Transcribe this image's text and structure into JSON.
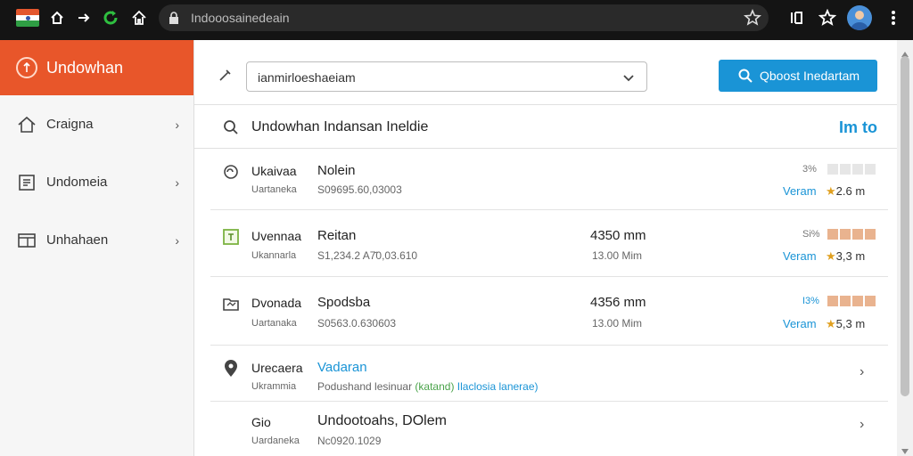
{
  "browser": {
    "url": "Indooosainedeain",
    "icons": [
      "flag-icon",
      "home-icon",
      "forward-icon",
      "reload-icon",
      "house-icon",
      "lock-icon",
      "bookmark-star-icon",
      "extension-icon",
      "star-icon",
      "avatar",
      "menu-icon"
    ]
  },
  "sidebar": {
    "brand": "Undowhan",
    "items": [
      {
        "label": "Craigna",
        "icon": "home-icon"
      },
      {
        "label": "Undomeia",
        "icon": "document-icon"
      },
      {
        "label": "Unhahaen",
        "icon": "window-icon"
      }
    ]
  },
  "toolbar": {
    "select_value": "ianmirloeshaeiam",
    "search_button": "Qboost Inedartam"
  },
  "results": {
    "title": "Undowhan Indansan Ineldie",
    "link": "Im to",
    "rows": [
      {
        "icon": "cloud-icon",
        "c1a": "Ukaivaa",
        "c1b": "Uartaneka",
        "c2a": "Nolein",
        "c2b": "S09695.60,03003",
        "pct": "3%",
        "lnk": "Veram",
        "rate_star": "★",
        "rate": "2.6 m"
      },
      {
        "icon": "calendar-icon",
        "c1a": "Uvennaa",
        "c1b": "Ukannarla",
        "c2a": "Reitan",
        "c2b": "S1,234.2 A7̆0,03.610",
        "c3a": "4350 mm",
        "c3b": "13.00 Mim",
        "pct": "Si%",
        "lnk": "Veram",
        "rate_star": "★",
        "rate": "3,3 m"
      },
      {
        "icon": "folder-icon",
        "c1a": "Dvonada",
        "c1b": "Uartanaka",
        "c2a": "Spodsba",
        "c2b": "S0563.0.630603",
        "c3a": "4356 mm",
        "c3b": "13.00 Mim",
        "pct": "I3%",
        "lnk": "Veram",
        "rate_star": "★",
        "rate": "5,3 m"
      },
      {
        "icon": "location-icon",
        "c1a": "Urecaera",
        "c1b": "Ukrammia",
        "c2a": "Vadaran",
        "c2b_pre": "Podushand lesinuar",
        "c2b_green": "(katand)",
        "c2b_blue": "Ilaclosia lanerae)"
      },
      {
        "icon": "",
        "c1a": "Gio",
        "c1b": "Uardaneka",
        "c2a": "Undootoahs, DOlem",
        "c2b": "Nc0920.1029"
      }
    ]
  },
  "colors": {
    "sidebar_header": "#e8562a",
    "accent": "#1a94d6",
    "meter_fill": "#e9b38f",
    "meter_empty": "#e6e6e6",
    "star": "#e0a020"
  }
}
